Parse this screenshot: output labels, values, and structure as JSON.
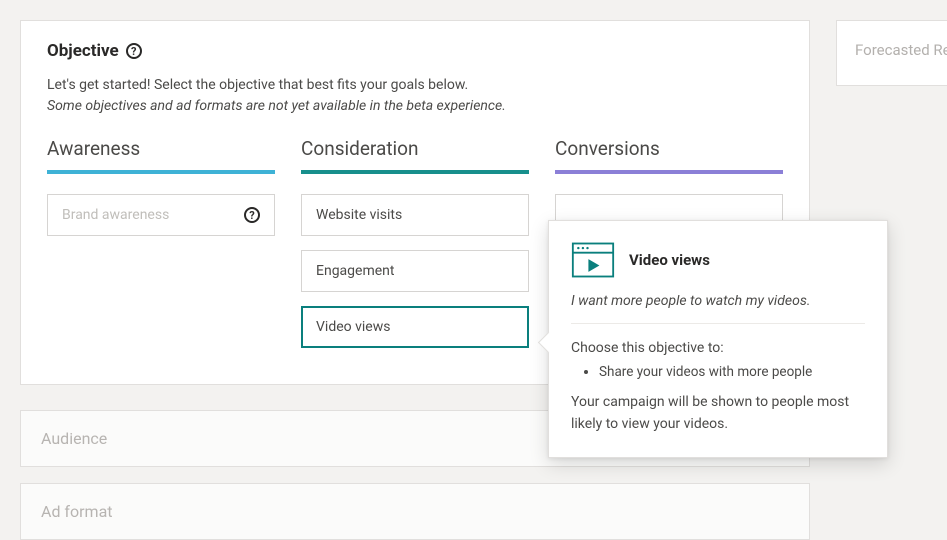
{
  "forecast": {
    "label": "Forecasted Re"
  },
  "objective": {
    "title": "Objective",
    "intro": "Let's get started! Select the objective that best fits your goals below.",
    "note": "Some objectives and ad formats are not yet available in the beta experience.",
    "columns": {
      "awareness": {
        "title": "Awareness",
        "options": [
          {
            "label": "Brand awareness",
            "disabled": true,
            "help": true
          }
        ]
      },
      "consideration": {
        "title": "Consideration",
        "options": [
          {
            "label": "Website visits"
          },
          {
            "label": "Engagement"
          },
          {
            "label": "Video views",
            "selected": true
          }
        ]
      },
      "conversions": {
        "title": "Conversions",
        "options": [
          {
            "label": ""
          }
        ]
      }
    }
  },
  "collapsed": {
    "audience": "Audience",
    "adformat": "Ad format"
  },
  "tooltip": {
    "title": "Video views",
    "subtitle": "I want more people to watch my videos.",
    "choose_label": "Choose this objective to:",
    "bullet1": "Share your videos with more people",
    "footer": "Your campaign will be shown to people most likely to view your videos."
  }
}
